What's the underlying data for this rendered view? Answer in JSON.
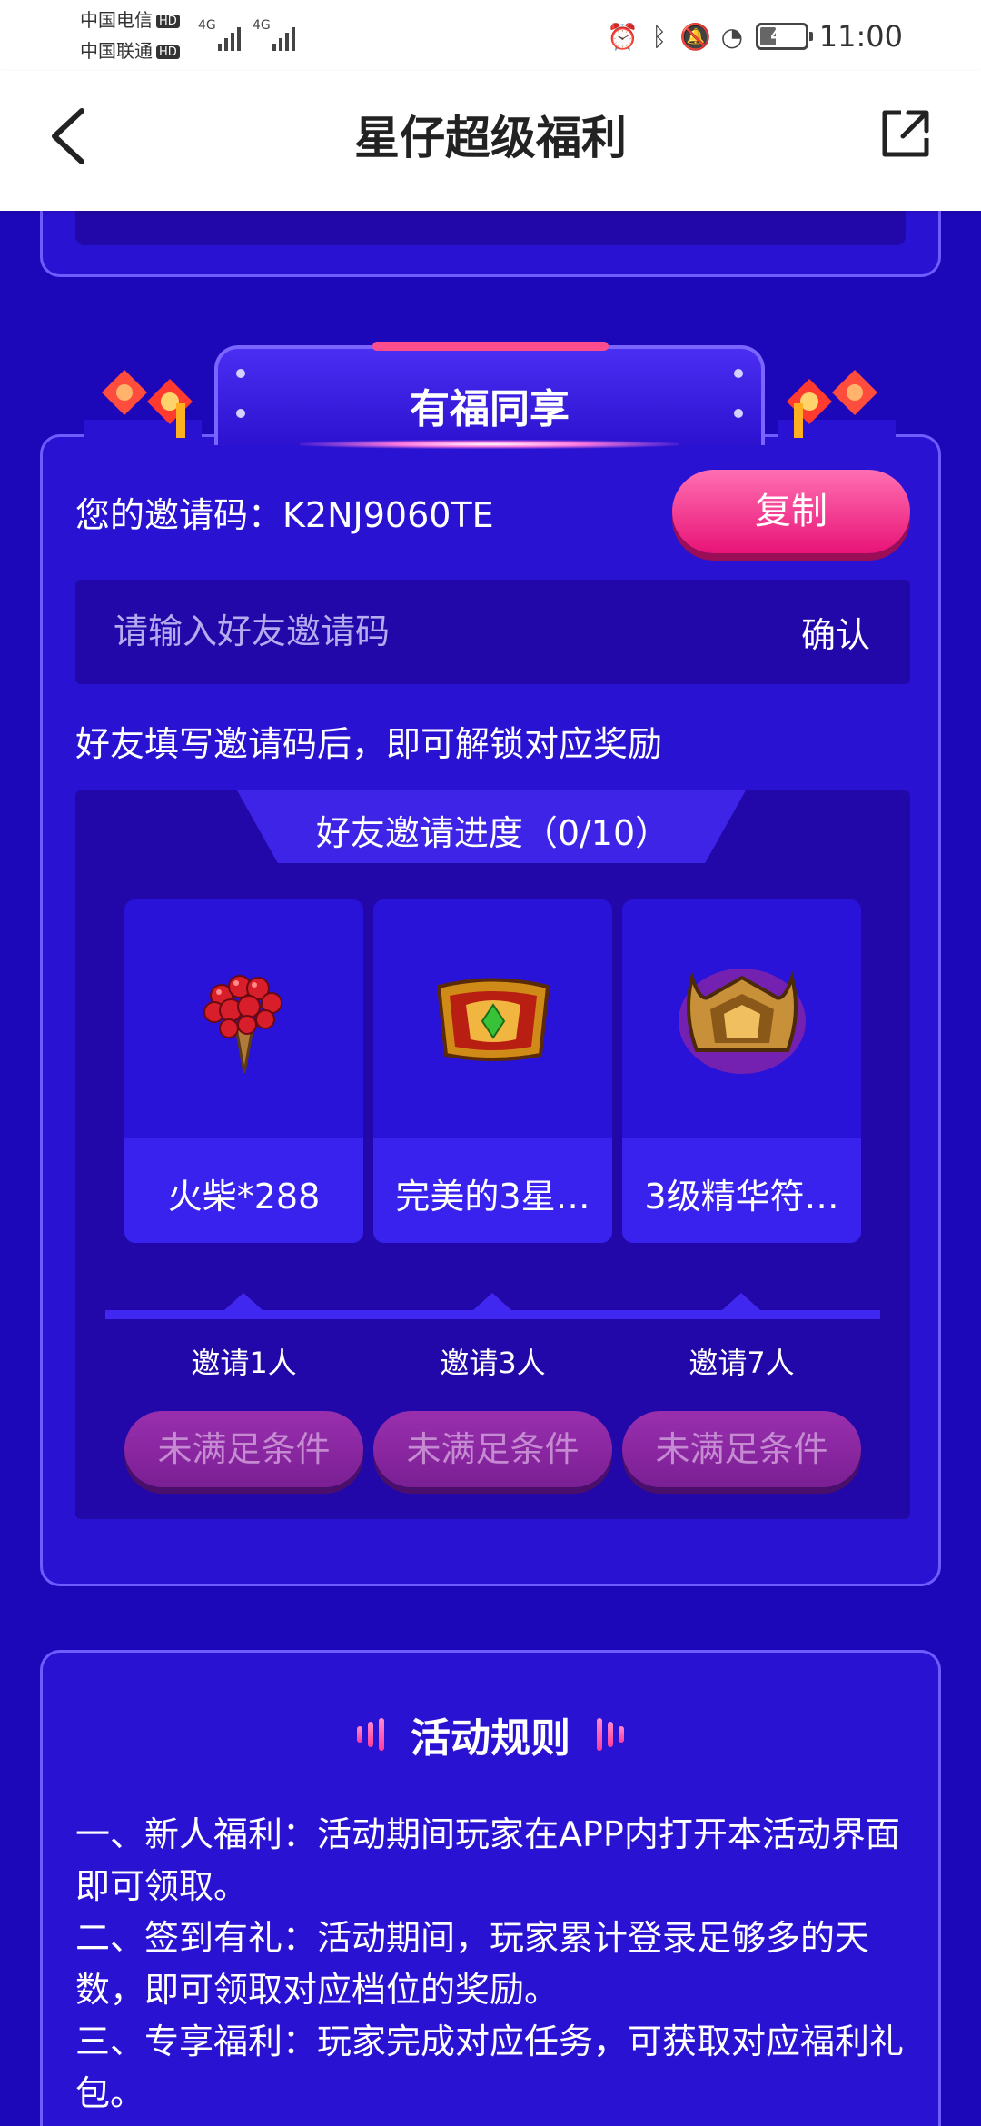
{
  "status_bar": {
    "carrier_1": "中国电信",
    "carrier_2": "中国联通",
    "hd": "HD",
    "network": "4G",
    "battery": "41",
    "battery_level_percent": 41,
    "time": "11:00",
    "icons": [
      "alarm-icon",
      "bluetooth-icon",
      "mute-icon",
      "speed-icon"
    ]
  },
  "header": {
    "title": "星仔超级福利",
    "back_icon": "back-arrow-icon",
    "share_icon": "share-icon"
  },
  "invite": {
    "banner_title": "有福同享",
    "code_label": "您的邀请码：K2NJ9060TE",
    "copy_label": "复制",
    "input_placeholder": "请输入好友邀请码",
    "confirm_label": "确认",
    "hint": "好友填写邀请码后，即可解锁对应奖励",
    "progress_title": "好友邀请进度（0/10）",
    "progress_current": 0,
    "progress_total": 10,
    "rewards": [
      {
        "name": "火柴*288",
        "icon": "matches-bundle-icon",
        "step": "邀请1人",
        "button": "未满足条件"
      },
      {
        "name": "完美的3星…",
        "icon": "gold-box-icon",
        "step": "邀请3人",
        "button": "未满足条件"
      },
      {
        "name": "3级精华符…",
        "icon": "essence-talisman-icon",
        "step": "邀请7人",
        "button": "未满足条件"
      }
    ]
  },
  "rules": {
    "title": "活动规则",
    "items": [
      "一、新人福利：活动期间玩家在APP内打开本活动界面即可领取。",
      "二、签到有礼：活动期间，玩家累计登录足够多的天数，即可领取对应档位的奖励。",
      "三、专享福利：玩家完成对应任务，可获取对应福利礼包。"
    ]
  },
  "colors": {
    "page_bg": "#1c08b8",
    "card_bg": "#2a12d2",
    "accent_pink": "#e81477",
    "disabled_purple": "#7a1f94"
  }
}
